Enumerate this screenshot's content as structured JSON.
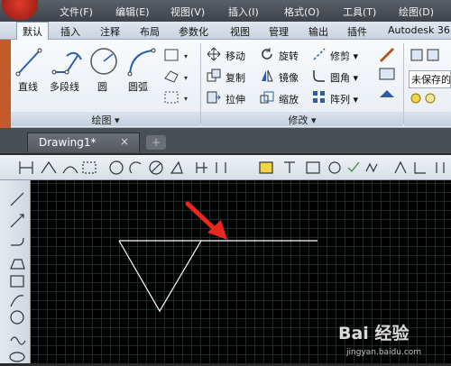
{
  "menubar": {
    "items": [
      "文件(F)",
      "编辑(E)",
      "视图(V)",
      "插入(I)",
      "格式(O)",
      "工具(T)",
      "绘图(D)"
    ]
  },
  "ribbon_tabs": {
    "items": [
      "默认",
      "插入",
      "注释",
      "布局",
      "参数化",
      "视图",
      "管理",
      "输出",
      "插件",
      "Autodesk 36"
    ],
    "active": "默认"
  },
  "draw_panel": {
    "title": "绘图 ▾",
    "tools": [
      "直线",
      "多段线",
      "圆",
      "圆弧"
    ]
  },
  "modify_panel": {
    "title": "修改 ▾",
    "tools": [
      "移动",
      "旋转",
      "修剪 ▾",
      "复制",
      "镜像",
      "圆角 ▾",
      "拉伸",
      "缩放",
      "阵列 ▾"
    ]
  },
  "layer_panel": {
    "state_label": "未保存的"
  },
  "document": {
    "tab_title": "Drawing1*",
    "close_glyph": "×"
  },
  "watermark": {
    "text": "Bai 经验",
    "url": "jingyan.baidu.com"
  },
  "colors": {
    "canvas_bg": "#000000",
    "grid": "#1f2a2a",
    "geometry": "#ffffff",
    "arrow": "#e8281e"
  }
}
